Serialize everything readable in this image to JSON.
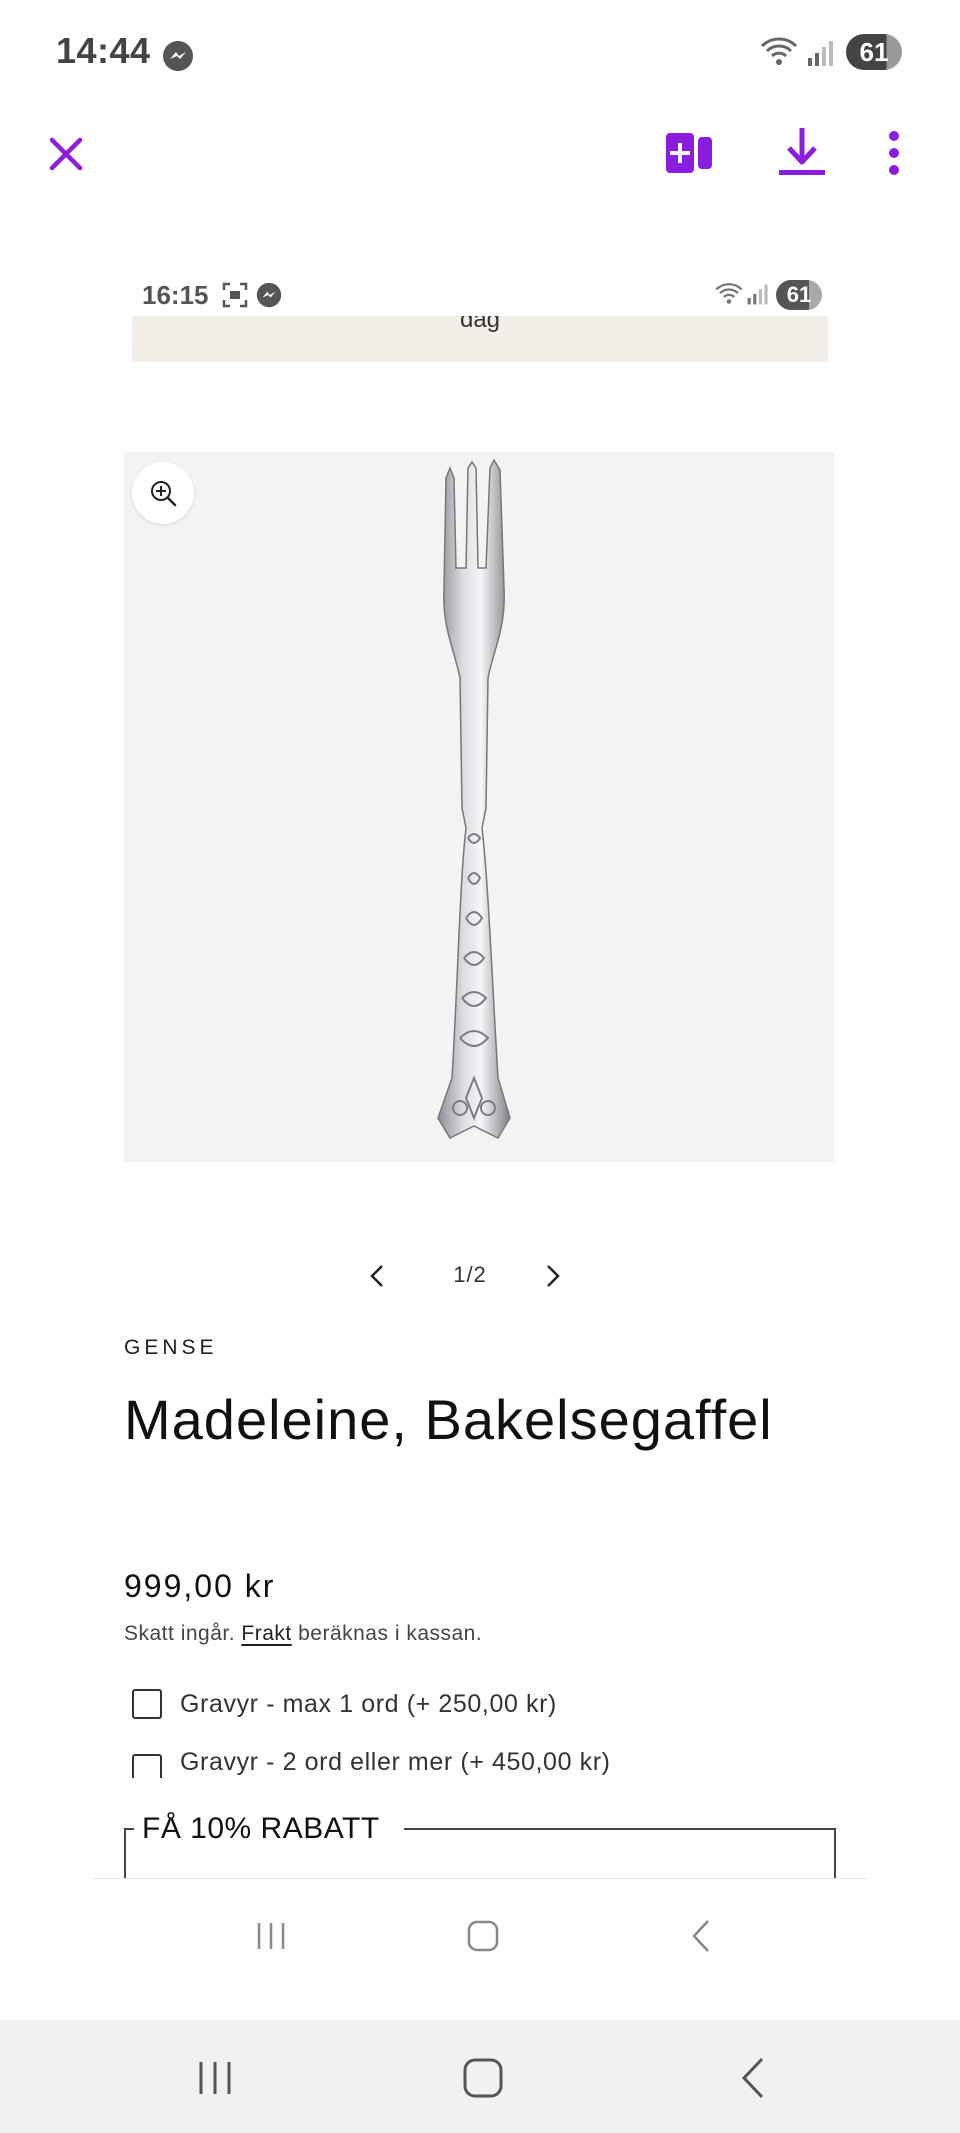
{
  "status_bar": {
    "time": "14:44",
    "battery": "61"
  },
  "toolbar": {
    "close_icon": "close-icon",
    "add_page_icon": "add-page-icon",
    "download_icon": "download-icon",
    "more_icon": "more-vertical-icon",
    "accent_color": "#8a1de0"
  },
  "screenshot": {
    "status_bar": {
      "time": "16:15",
      "battery": "61"
    },
    "announcement": "dag",
    "gallery": {
      "page_indicator": "1/2",
      "zoom_icon": "zoom-in-icon"
    },
    "product": {
      "vendor": "GENSE",
      "title": "Madeleine, Bakelsegaffel",
      "price": "999,00 kr",
      "tax_prefix": "Skatt ingår.",
      "tax_link": "Frakt",
      "tax_suffix": "beräknas i kassan.",
      "options": [
        {
          "label": "Gravyr - max 1 ord (+ 250,00 kr)",
          "checked": false
        },
        {
          "label": "Gravyr - 2 ord eller mer (+ 450,00 kr)",
          "checked": false
        }
      ]
    },
    "discount_banner": "FÅ 10% RABATT"
  }
}
